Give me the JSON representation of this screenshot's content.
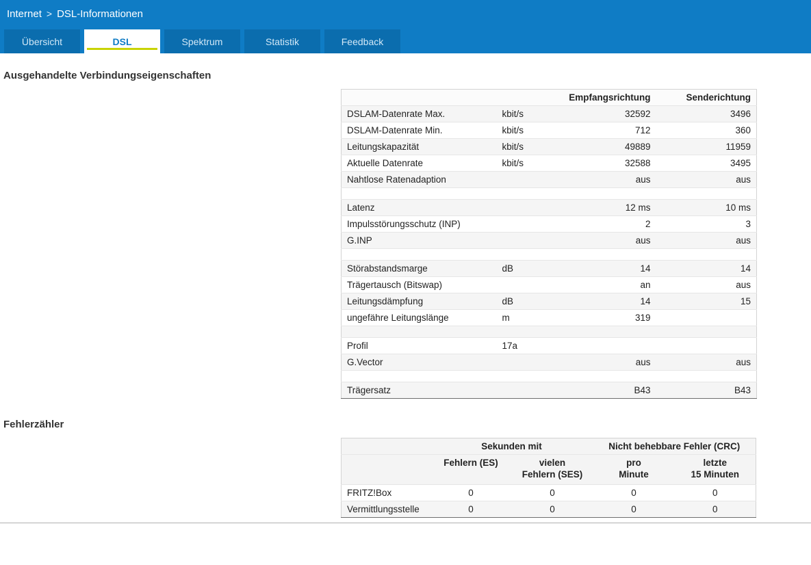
{
  "header": {
    "breadcrumb": {
      "section": "Internet",
      "separator": ">",
      "page": "DSL-Informationen"
    },
    "tabs": [
      {
        "label": "Übersicht",
        "active": false
      },
      {
        "label": "DSL",
        "active": true
      },
      {
        "label": "Spektrum",
        "active": false
      },
      {
        "label": "Statistik",
        "active": false
      },
      {
        "label": "Feedback",
        "active": false
      }
    ]
  },
  "sections": {
    "connection": {
      "title": "Ausgehandelte Verbindungseigenschaften",
      "table": {
        "direction_headers": [
          "Empfangsrichtung",
          "Senderichtung"
        ],
        "rows": [
          [
            "DSLAM-Datenrate Max.",
            "kbit/s",
            "32592",
            "3496"
          ],
          [
            "DSLAM-Datenrate Min.",
            "kbit/s",
            "712",
            "360"
          ],
          [
            "Leitungskapazität",
            "kbit/s",
            "49889",
            "11959"
          ],
          [
            "Aktuelle Datenrate",
            "kbit/s",
            "32588",
            "3495"
          ],
          [
            "Nahtlose Ratenadaption",
            "",
            "aus",
            "aus"
          ],
          [
            "",
            "",
            "",
            ""
          ],
          [
            "Latenz",
            "",
            "12 ms",
            "10 ms"
          ],
          [
            "Impulsstörungsschutz (INP)",
            "",
            "2",
            "3"
          ],
          [
            "G.INP",
            "",
            "aus",
            "aus"
          ],
          [
            "",
            "",
            "",
            ""
          ],
          [
            "Störabstandsmarge",
            "dB",
            "14",
            "14"
          ],
          [
            "Trägertausch (Bitswap)",
            "",
            "an",
            "aus"
          ],
          [
            "Leitungsdämpfung",
            "dB",
            "14",
            "15"
          ],
          [
            "ungefähre Leitungslänge",
            "m",
            "319",
            ""
          ],
          [
            "",
            "",
            "",
            ""
          ],
          [
            "Profil",
            "17a",
            "",
            ""
          ],
          [
            "G.Vector",
            "",
            "aus",
            "aus"
          ],
          [
            "",
            "",
            "",
            ""
          ],
          [
            "Trägersatz",
            "",
            "B43",
            "B43"
          ]
        ]
      }
    },
    "errors": {
      "title": "Fehlerzähler",
      "table": {
        "group_headers": [
          "Sekunden mit",
          "Nicht behebbare Fehler (CRC)"
        ],
        "col_headers": [
          "Fehlern (ES)",
          "vielen\nFehlern (SES)",
          "pro\nMinute",
          "letzte\n15 Minuten"
        ],
        "rows": [
          [
            "FRITZ!Box",
            "0",
            "0",
            "0",
            "0"
          ],
          [
            "Vermittlungsstelle",
            "0",
            "0",
            "0",
            "0"
          ]
        ]
      }
    }
  },
  "colors": {
    "header_blue": "#0f7cc5",
    "tab_inactive_blue": "#0b6dae",
    "accent_yellow_green": "#c8d300",
    "row_stripe": "#f5f5f5"
  }
}
